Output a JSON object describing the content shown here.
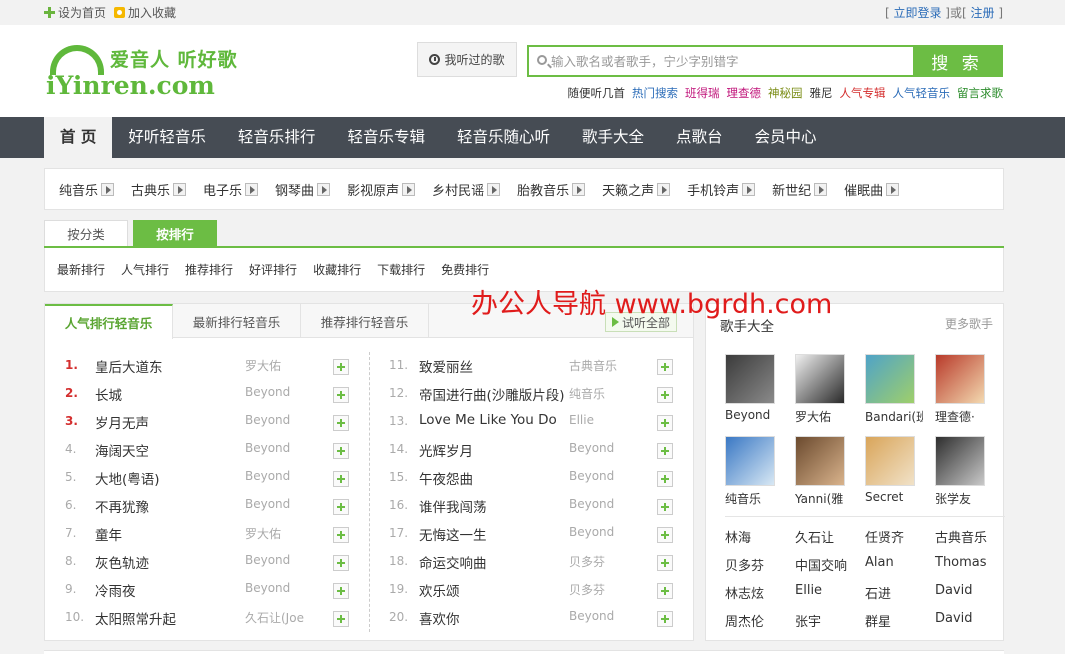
{
  "topbar": {
    "set_home": "设为首页",
    "add_fav": "加入收藏",
    "bracket_open": "[ ",
    "login": "立即登录",
    "sep": " ]或[ ",
    "register": "注册",
    "bracket_close": " ]"
  },
  "header": {
    "logo_slogan": "爱音人 听好歌",
    "logo_domain": "iYinren.com",
    "heard_button": "我听过的歌",
    "search_placeholder": "输入歌名或者歌手，宁少字别错字",
    "search_button": "搜 索",
    "hotlinks": [
      {
        "label": "随便听几首",
        "color": "#333333"
      },
      {
        "label": "热门搜索",
        "color": "#2b6cb8"
      },
      {
        "label": "班得瑞",
        "color": "#c0147a"
      },
      {
        "label": "理查德",
        "color": "#c0147a"
      },
      {
        "label": "神秘园",
        "color": "#7a8c14"
      },
      {
        "label": "雅尼",
        "color": "#333333"
      },
      {
        "label": "人气专辑",
        "color": "#d42f2f"
      },
      {
        "label": "人气轻音乐",
        "color": "#2b6cb8"
      },
      {
        "label": "留言求歌",
        "color": "#2b8c2b"
      }
    ]
  },
  "nav": [
    "首 页",
    "好听轻音乐",
    "轻音乐排行",
    "轻音乐专辑",
    "轻音乐随心听",
    "歌手大全",
    "点歌台",
    "会员中心"
  ],
  "categories": [
    "纯音乐",
    "古典乐",
    "电子乐",
    "钢琴曲",
    "影视原声",
    "乡村民谣",
    "胎教音乐",
    "天籁之声",
    "手机铃声",
    "新世纪",
    "催眠曲"
  ],
  "subtabs": [
    "按分类",
    "按排行"
  ],
  "sorts": [
    "最新排行",
    "人气排行",
    "推荐排行",
    "好评排行",
    "收藏排行",
    "下载排行",
    "免费排行"
  ],
  "rank": {
    "tabs": [
      "人气排行轻音乐",
      "最新排行轻音乐",
      "推荐排行轻音乐"
    ],
    "listen_all": "试听全部",
    "left": [
      {
        "num": "1.",
        "title": "皇后大道东",
        "artist": "罗大佑"
      },
      {
        "num": "2.",
        "title": "长城",
        "artist": "Beyond"
      },
      {
        "num": "3.",
        "title": "岁月无声",
        "artist": "Beyond"
      },
      {
        "num": "4.",
        "title": "海阔天空",
        "artist": "Beyond"
      },
      {
        "num": "5.",
        "title": "大地(粤语)",
        "artist": "Beyond"
      },
      {
        "num": "6.",
        "title": "不再犹豫",
        "artist": "Beyond"
      },
      {
        "num": "7.",
        "title": "童年",
        "artist": "罗大佑"
      },
      {
        "num": "8.",
        "title": "灰色轨迹",
        "artist": "Beyond"
      },
      {
        "num": "9.",
        "title": "冷雨夜",
        "artist": "Beyond"
      },
      {
        "num": "10.",
        "title": "太阳照常升起",
        "artist": "久石让(Joe"
      }
    ],
    "right": [
      {
        "num": "11.",
        "title": "致爱丽丝",
        "artist": "古典音乐"
      },
      {
        "num": "12.",
        "title": "帝国进行曲(沙雕版片段)",
        "artist": "纯音乐"
      },
      {
        "num": "13.",
        "title": "Love Me Like You Do",
        "artist": "Ellie"
      },
      {
        "num": "14.",
        "title": "光辉岁月",
        "artist": "Beyond"
      },
      {
        "num": "15.",
        "title": "午夜怨曲",
        "artist": "Beyond"
      },
      {
        "num": "16.",
        "title": "谁伴我闯荡",
        "artist": "Beyond"
      },
      {
        "num": "17.",
        "title": "无悔这一生",
        "artist": "Beyond"
      },
      {
        "num": "18.",
        "title": "命运交响曲",
        "artist": "贝多芬"
      },
      {
        "num": "19.",
        "title": "欢乐颂",
        "artist": "贝多芬"
      },
      {
        "num": "20.",
        "title": "喜欢你",
        "artist": "Beyond"
      }
    ]
  },
  "singers": {
    "title": "歌手大全",
    "more": "更多歌手",
    "avatars": [
      {
        "name": "Beyond",
        "c1": "#3b3b3b",
        "c2": "#8a8a8a"
      },
      {
        "name": "罗大佑",
        "c1": "#f0f0f0",
        "c2": "#2a2a2a"
      },
      {
        "name": "Bandari(班",
        "c1": "#4fa3c8",
        "c2": "#9fcf6a"
      },
      {
        "name": "理查德·",
        "c1": "#b83a2a",
        "c2": "#f3d9b0"
      },
      {
        "name": "纯音乐",
        "c1": "#3a78c4",
        "c2": "#d8e8f4"
      },
      {
        "name": "Yanni(雅",
        "c1": "#6b4a2e",
        "c2": "#d9b38c"
      },
      {
        "name": "Secret",
        "c1": "#d9a55a",
        "c2": "#f1e2c8"
      },
      {
        "name": "张学友",
        "c1": "#2e2e2e",
        "c2": "#c9c9c9"
      }
    ],
    "names": [
      [
        "林海",
        "久石让",
        "任贤齐",
        "古典音乐"
      ],
      [
        "贝多芬",
        "中国交响",
        "Alan",
        "Thomas"
      ],
      [
        "林志炫",
        "Ellie",
        "石进",
        "David"
      ],
      [
        "周杰伦",
        "张宇",
        "群星",
        "David"
      ]
    ]
  },
  "watermark": "办公人导航 www.bgrdh.com"
}
